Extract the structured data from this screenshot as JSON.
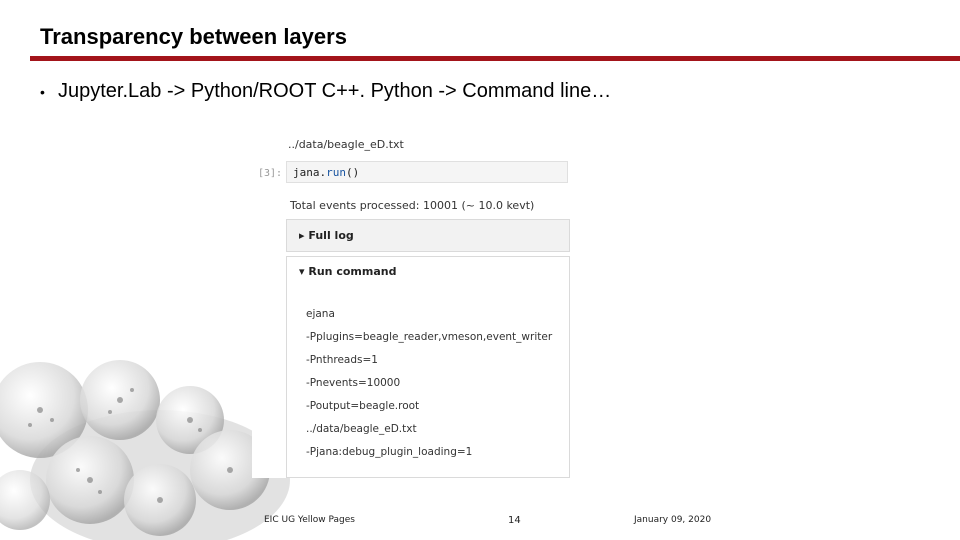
{
  "slide": {
    "title": "Transparency between layers",
    "bullet": "Jupyter.Lab -> Python/ROOT C++. Python -> Command line…",
    "bullet_symbol": "•"
  },
  "notebook": {
    "path_above": "../data/beagle_eD.txt",
    "prompt": "[3]:",
    "code_obj": "jana.",
    "code_fn": "run",
    "code_args": "()",
    "output_text": "Total events processed: 10001 (~ 10.0 kevt)",
    "full_log_label": "Full log",
    "run_command_label": "Run command",
    "command_lines": [
      "ejana",
      "-Pplugins=beagle_reader,vmeson,event_writer",
      "-Pnthreads=1",
      "-Pnevents=10000",
      "-Poutput=beagle.root",
      "../data/beagle_eD.txt",
      "-Pjana:debug_plugin_loading=1"
    ]
  },
  "footer": {
    "left": "EIC UG Yellow Pages",
    "page_number": "14",
    "date": "January 09, 2020"
  },
  "colors": {
    "accent_rule": "#a3141a",
    "code_function": "#1a55a0"
  }
}
